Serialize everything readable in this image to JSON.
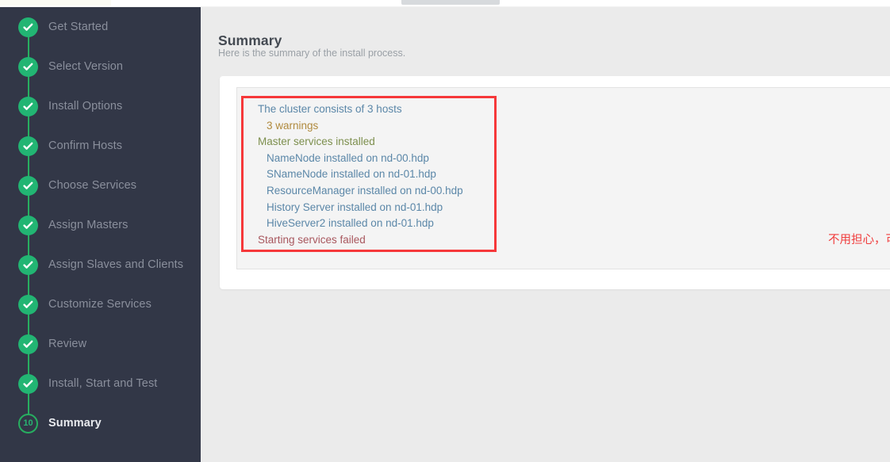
{
  "window": {
    "top_chrome": {
      "cream_strip": "",
      "grey_tab": ""
    }
  },
  "sidebar": {
    "steps": [
      {
        "label": "Get Started",
        "state": "done",
        "badge": ""
      },
      {
        "label": "Select Version",
        "state": "done",
        "badge": ""
      },
      {
        "label": "Install Options",
        "state": "done",
        "badge": ""
      },
      {
        "label": "Confirm Hosts",
        "state": "done",
        "badge": ""
      },
      {
        "label": "Choose Services",
        "state": "done",
        "badge": ""
      },
      {
        "label": "Assign Masters",
        "state": "done",
        "badge": ""
      },
      {
        "label": "Assign Slaves and Clients",
        "state": "done",
        "badge": ""
      },
      {
        "label": "Customize Services",
        "state": "done",
        "badge": ""
      },
      {
        "label": "Review",
        "state": "done",
        "badge": ""
      },
      {
        "label": "Install, Start and Test",
        "state": "done",
        "badge": ""
      },
      {
        "label": "Summary",
        "state": "current",
        "badge": "10"
      }
    ]
  },
  "main": {
    "title": "Summary",
    "subtitle": "Here is the summary of the install process.",
    "status_list": [
      {
        "text": "The cluster consists of 3 hosts",
        "level": 0,
        "color": "#5b87a8"
      },
      {
        "text": "3 warnings",
        "level": 1,
        "color": "#b08a3e"
      },
      {
        "text": "Master services installed",
        "level": 0,
        "color": "#7d8f4e"
      },
      {
        "text": "NameNode installed on nd-00.hdp",
        "level": 1,
        "color": "#5b87a8"
      },
      {
        "text": "SNameNode installed on nd-01.hdp",
        "level": 1,
        "color": "#5b87a8"
      },
      {
        "text": "ResourceManager installed on nd-00.hdp",
        "level": 1,
        "color": "#5b87a8"
      },
      {
        "text": "History Server installed on nd-01.hdp",
        "level": 1,
        "color": "#5b87a8"
      },
      {
        "text": "HiveServer2 installed on nd-01.hdp",
        "level": 1,
        "color": "#5b87a8"
      },
      {
        "text": "Starting services failed",
        "level": 0,
        "color": "#a8575e"
      }
    ],
    "annotation": {
      "text": "不用担心，可以从监控平台重启出问题的组件",
      "color": "#f03c3c"
    },
    "highlight_box_color": "#f6383a"
  },
  "colors": {
    "sidebar_bg": "#323747",
    "step_done": "#22b573",
    "step_connector": "#27ae60",
    "content_bg": "#ebebeb",
    "card_bg": "#ffffff",
    "panel_bg": "#f4f4f4"
  }
}
